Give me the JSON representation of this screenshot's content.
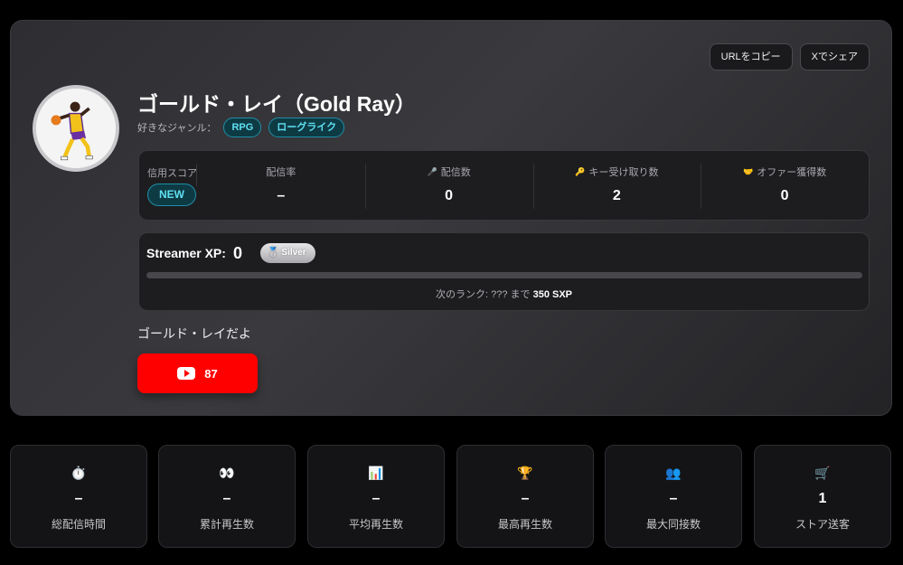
{
  "actions": {
    "copy_url": "URLをコピー",
    "share_x": "Xでシェア"
  },
  "profile": {
    "name": "ゴールド・レイ（Gold Ray）",
    "genre_label": "好きなジャンル：",
    "genres": [
      "RPG",
      "ローグライク"
    ],
    "bio": "ゴールド・レイだよ"
  },
  "stats": {
    "credit_label": "信用スコア",
    "credit_badge": "NEW",
    "items": [
      {
        "icon": "",
        "label": "配信率",
        "value": "–"
      },
      {
        "icon": "🎤",
        "label": "配信数",
        "value": "0"
      },
      {
        "icon": "🔑",
        "label": "キー受け取り数",
        "value": "2"
      },
      {
        "icon": "🤝",
        "label": "オファー獲得数",
        "value": "0"
      }
    ]
  },
  "xp": {
    "label": "Streamer XP:",
    "value": "0",
    "rank": "Silver",
    "rank_icon": "🥈",
    "progress_fraction": 0,
    "next_prefix": "次のランク: ??? まで",
    "next_amount": "350 SXP",
    "accent_color": "#7b5cff"
  },
  "youtube": {
    "count": "87",
    "color": "#ff0000"
  },
  "metrics": [
    {
      "icon": "⏱️",
      "icon_name": "stopwatch-icon",
      "value": "–",
      "label": "総配信時間"
    },
    {
      "icon": "👀",
      "icon_name": "eyes-icon",
      "value": "–",
      "label": "累計再生数"
    },
    {
      "icon": "📊",
      "icon_name": "bar-chart-icon",
      "value": "–",
      "label": "平均再生数"
    },
    {
      "icon": "🏆",
      "icon_name": "trophy-icon",
      "value": "–",
      "label": "最高再生数"
    },
    {
      "icon": "👥",
      "icon_name": "people-icon",
      "value": "–",
      "label": "最大同接数"
    },
    {
      "icon": "🛒",
      "icon_name": "cart-icon",
      "value": "1",
      "label": "ストア送客"
    }
  ]
}
